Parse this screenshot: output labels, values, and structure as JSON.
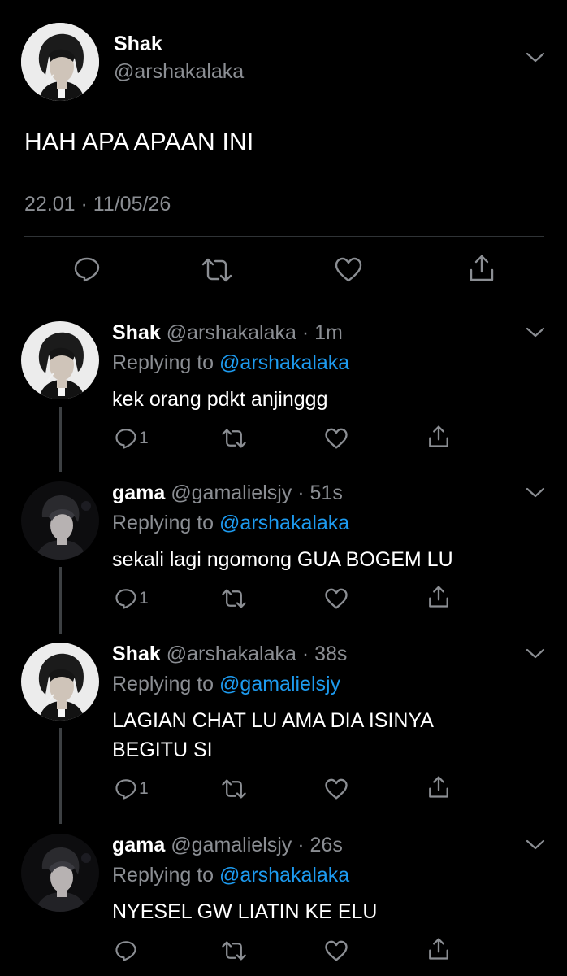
{
  "main_tweet": {
    "name": "Shak",
    "handle": "@arshakalaka",
    "text": "HAH APA APAAN INI",
    "timestamp": "22.01 · 11/05/26",
    "actions": [
      "reply-icon",
      "retweet-icon",
      "like-icon",
      "share-icon"
    ]
  },
  "replies": [
    {
      "name": "Shak",
      "handle": "@arshakalaka",
      "time": "1m",
      "replying_prefix": "Replying to ",
      "replying_to": "@arshakalaka",
      "text_lines": [
        "kek orang pdkt anjinggg"
      ],
      "reply_count": "1"
    },
    {
      "name": "gama",
      "handle": "@gamalielsjy",
      "time": "51s",
      "replying_prefix": "Replying to ",
      "replying_to": "@arshakalaka",
      "text_lines": [
        "sekali lagi ngomong GUA BOGEM LU"
      ],
      "reply_count": "1"
    },
    {
      "name": "Shak",
      "handle": "@arshakalaka",
      "time": "38s",
      "replying_prefix": "Replying to ",
      "replying_to": "@gamalielsjy",
      "text_lines": [
        "LAGIAN CHAT LU AMA DIA ISINYA",
        "BEGITU SI"
      ],
      "reply_count": "1"
    },
    {
      "name": "gama",
      "handle": "@gamalielsjy",
      "time": "26s",
      "replying_prefix": "Replying to ",
      "replying_to": "@arshakalaka",
      "text_lines": [
        "NYESEL GW LIATIN KE ELU"
      ],
      "reply_count": ""
    }
  ],
  "colors": {
    "background": "#000000",
    "primary_text": "#ffffff",
    "secondary_text": "#8b8e93",
    "mention": "#1d9bf0",
    "divider": "#2f3336",
    "icon": "#8b8e93"
  }
}
